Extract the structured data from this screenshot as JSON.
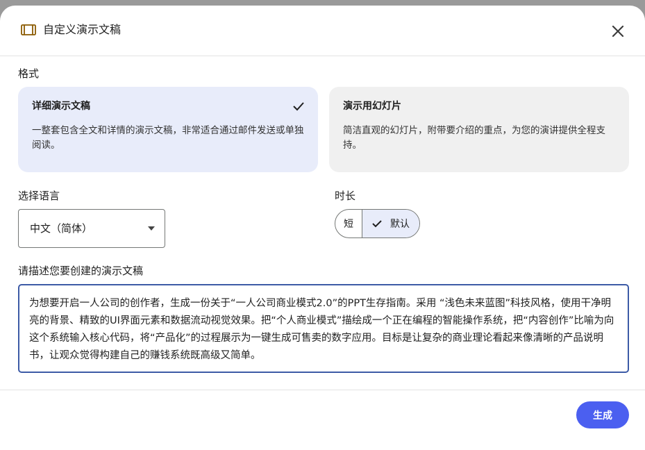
{
  "dialog": {
    "title": "自定义演示文稿",
    "title_icon": "slides-icon",
    "close_icon": "close-icon"
  },
  "format": {
    "label": "格式",
    "options": [
      {
        "title": "详细演示文稿",
        "description": "一整套包含全文和详情的演示文稿，非常适合通过邮件发送或单独阅读。",
        "selected": true
      },
      {
        "title": "演示用幻灯片",
        "description": "简洁直观的幻灯片，附带要介绍的重点，为您的演讲提供全程支持。",
        "selected": false
      }
    ]
  },
  "language": {
    "label": "选择语言",
    "selected": "中文（简体）"
  },
  "duration": {
    "label": "时长",
    "options": [
      "短",
      "默认"
    ],
    "selected": "默认"
  },
  "prompt": {
    "label": "请描述您要创建的演示文稿",
    "value": "为想要开启一人公司的创作者，生成一份关于“一人公司商业模式2.0”的PPT生存指南。采用 “浅色未来蓝图”科技风格，使用干净明亮的背景、精致的UI界面元素和数据流动视觉效果。把“个人商业模式”描绘成一个正在编程的智能操作系统，把“内容创作”比喻为向这个系统输入核心代码，将“产品化”的过程展示为一键生成可售卖的数字应用。目标是让复杂的商业理论看起来像清晰的产品说明书，让观众觉得构建自己的赚钱系统既高级又简单。"
  },
  "actions": {
    "generate_label": "生成"
  },
  "colors": {
    "accent": "#4b5ff0",
    "selected_bg": "#e8ecfa",
    "unselected_bg": "#f0f0f0",
    "input_border_focus": "#3c5aa6"
  }
}
